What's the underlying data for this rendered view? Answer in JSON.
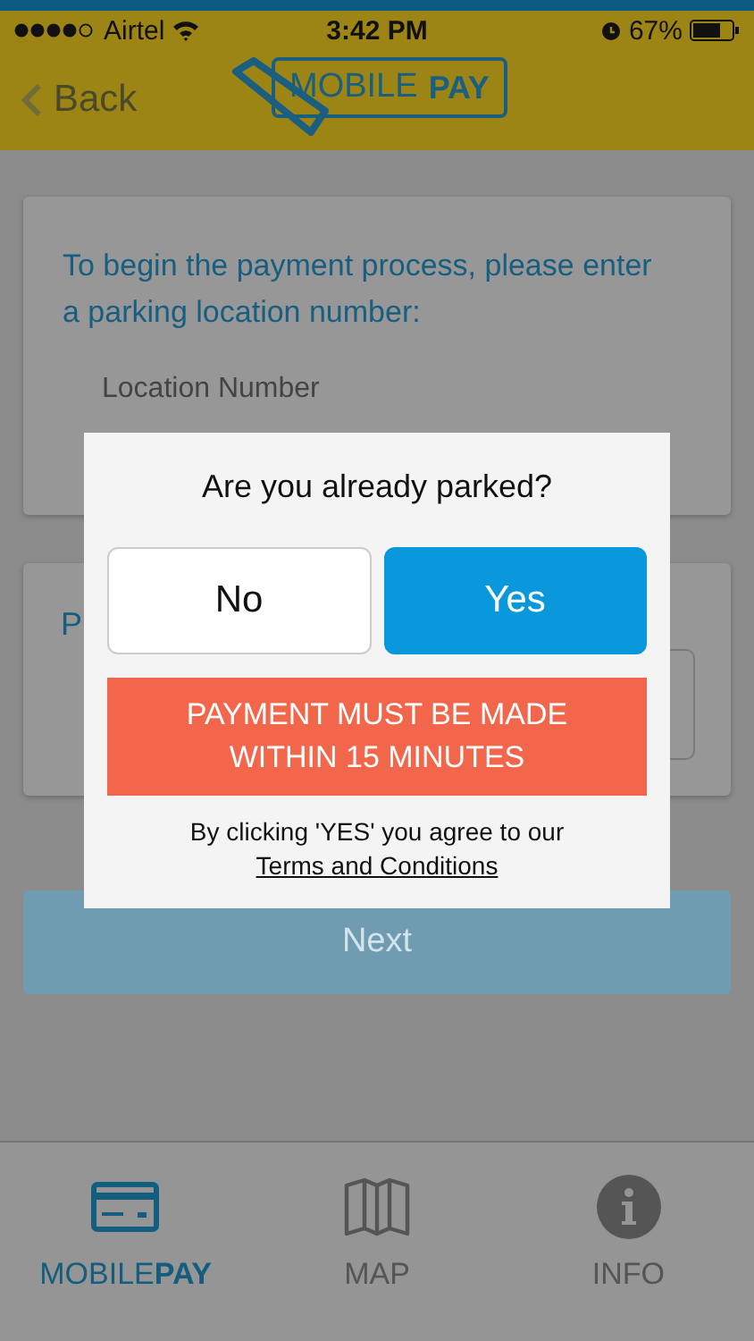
{
  "status_bar": {
    "carrier": "Airtel",
    "time": "3:42 PM",
    "battery": "67%"
  },
  "header": {
    "back": "Back",
    "logo_text": "MOBILE",
    "logo_pay": "PAY"
  },
  "location_card": {
    "instruction": "To begin the payment process, please enter a parking location number:",
    "placeholder": "Location Number"
  },
  "second_card": {
    "label": "P"
  },
  "next_button": "Next",
  "dialog": {
    "title": "Are you already parked?",
    "buttons": [
      {
        "label": "No",
        "selected": false
      },
      {
        "label": "Yes",
        "selected": true
      }
    ],
    "warning": "PAYMENT MUST BE MADE WITHIN 15 MINUTES",
    "note": "By clicking 'YES' you agree to our",
    "link": "Terms and Conditions"
  },
  "tabs": [
    {
      "kind": "card",
      "label": "MOBILE**PAY**",
      "selected": true
    },
    {
      "kind": "map",
      "label": "MAP",
      "selected": false
    },
    {
      "kind": "info",
      "label": "INFO",
      "selected": false
    }
  ]
}
